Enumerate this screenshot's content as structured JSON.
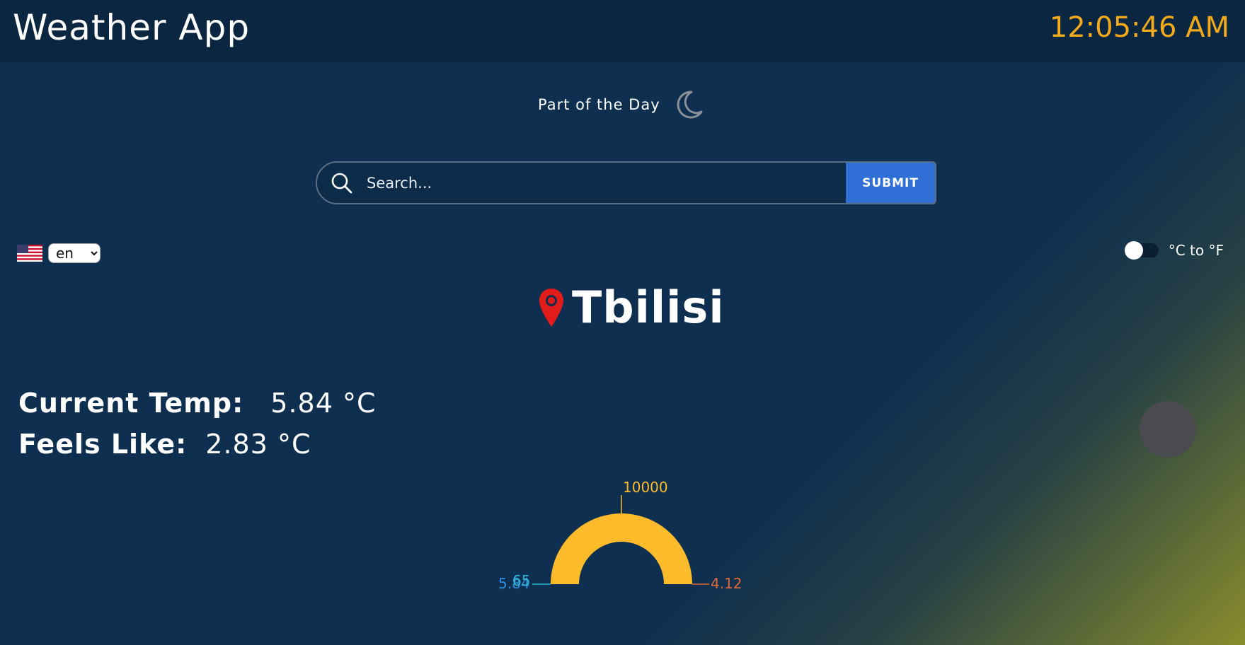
{
  "header": {
    "title": "Weather App",
    "time": "12:05:46 AM"
  },
  "part_of_day": {
    "label": "Part of the Day",
    "icon": "moon-icon"
  },
  "search": {
    "placeholder": "Search...",
    "value": "",
    "submit_label": "SUBMIT"
  },
  "language": {
    "selected": "en",
    "flag": "us-flag-icon"
  },
  "unit_toggle": {
    "label": "°C to °F",
    "enabled": false
  },
  "location": {
    "city": "Tbilisi"
  },
  "temperature": {
    "current_label": "Current Temp:",
    "current_value": "5.84 °C",
    "feels_label": "Feels Like:",
    "feels_value": "2.83 °C"
  },
  "gauge": {
    "top_label": "10000",
    "left_label_a": "5.84",
    "left_label_b": "65",
    "right_label": "4.12"
  },
  "colors": {
    "background": "#0e2f4f",
    "header": "#0b2640",
    "clock": "#f2a91c",
    "submit": "#2f6fd6",
    "gauge_fill": "#fbbb2a",
    "pin": "#e21b1b"
  }
}
